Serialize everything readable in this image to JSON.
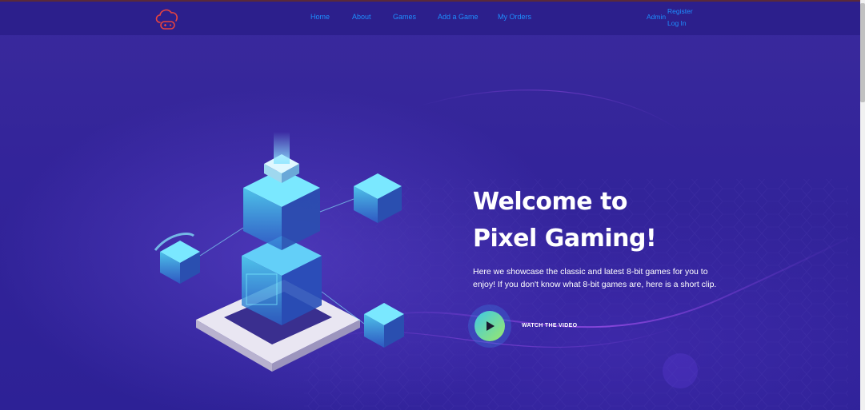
{
  "navbar": {
    "links": [
      {
        "label": "Home"
      },
      {
        "label": "About"
      },
      {
        "label": "Games"
      },
      {
        "label": "Add a Game"
      },
      {
        "label": "My Orders"
      }
    ],
    "admin_label": "Admin",
    "register_label": "Register",
    "login_label": "Log In"
  },
  "hero": {
    "title_line1": "Welcome to",
    "title_line2": "Pixel Gaming!",
    "description": "Here we showcase the classic and latest 8-bit games for you to enjoy! If you don't know what 8-bit games are, here is a short clip.",
    "watch_label": "WATCH THE VIDEO"
  },
  "colors": {
    "background": "#2f2290",
    "navbar": "#2c1f8c",
    "link": "#1e8fff",
    "logo": "#e8433f",
    "play_gradient_start": "#3ec8e6",
    "play_gradient_end": "#9be86a"
  },
  "icons": {
    "logo": "cloud-gamepad-icon",
    "play": "play-icon"
  }
}
